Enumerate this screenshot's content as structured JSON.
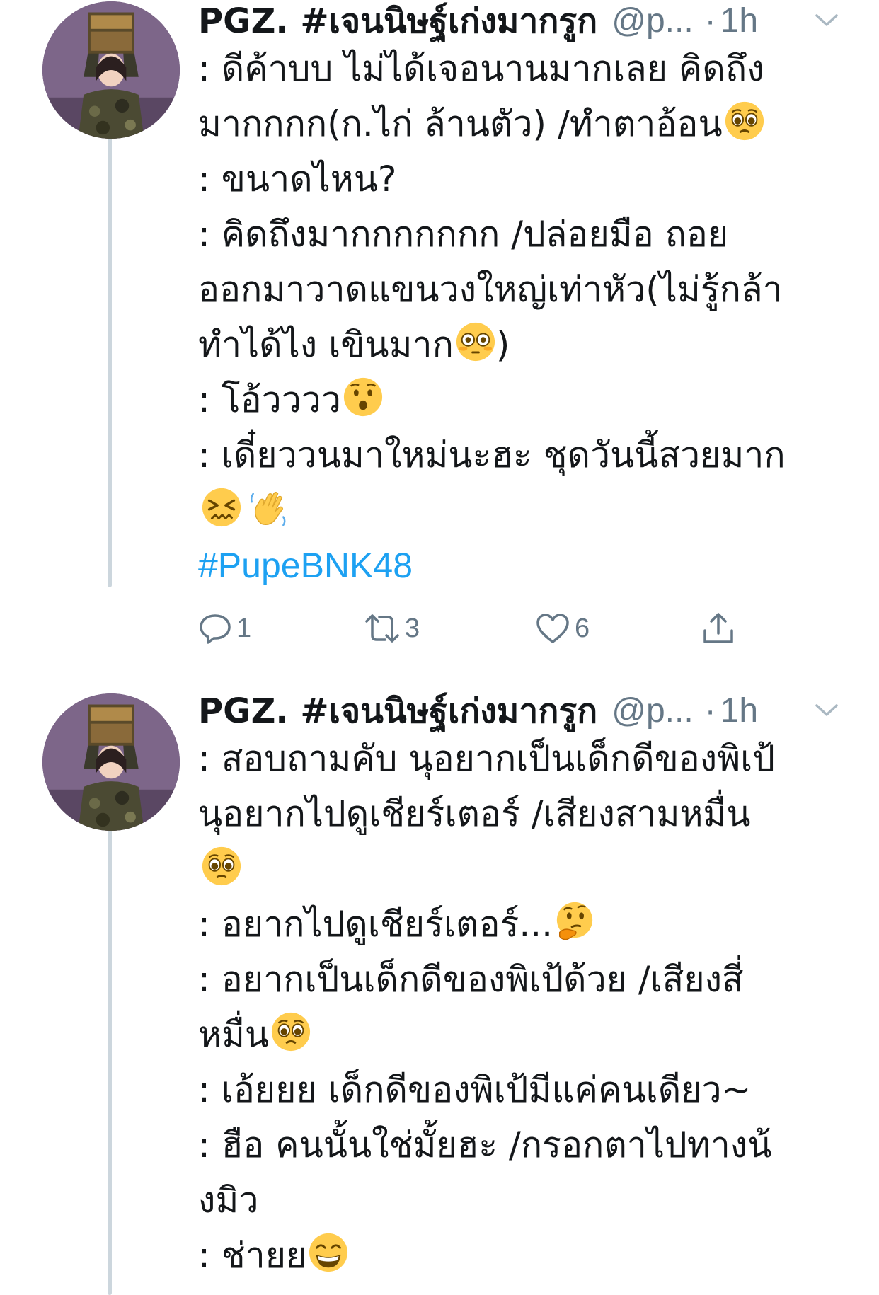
{
  "tweets": [
    {
      "display_name": "PGZ. #เจนนิษฐ์เก่งมากรูก",
      "handle": "@p...",
      "separator": "·",
      "time": "1h",
      "lines": [
        ": ดีค้าบบ ไม่ได้เจอนานมากเลย คิดถึง",
        "มากกกก(ก.ไก่ ล้านตัว) /ทำตาอ้อน",
        ": ขนาดไหน?",
        ": คิดถึงมากกกกกกก /ปล่อยมือ ถอย",
        "ออกมาวาดแขนวงใหญ่เท่าหัว(ไม่รู้กล้า",
        "ทำได้ไง เขินมาก",
        ")",
        ": โอ้วววว",
        ": เดี๋ยววนมาใหม่นะฮะ ชุดวันนี้สวยมาก"
      ],
      "hashtag": "#PupeBNK48",
      "actions": {
        "reply_count": "1",
        "retweet_count": "3",
        "like_count": "6"
      }
    },
    {
      "display_name": "PGZ. #เจนนิษฐ์เก่งมากรูก",
      "handle": "@p...",
      "separator": "·",
      "time": "1h",
      "lines": [
        ": สอบถามคับ นุอยากเป็นเด็กดีของพิเป้",
        "นุอยากไปดูเชียร์เตอร์ /เสียงสามหมื่น",
        ": อยากไปดูเชียร์เตอร์...",
        ": อยากเป็นเด็กดีของพิเป้ด้วย /เสียงสี่",
        "หมื่น",
        ": เอ้ยยย เด็กดีของพิเป้มีแค่คนเดียว~",
        ": ฮือ คนนั้นใช่มั้ยฮะ /กรอกตาไปทางน้",
        "งมิว",
        ": ช่ายย"
      ]
    }
  ],
  "icons": {
    "pleading": "pleading-face-icon",
    "flushed": "flushed-face-icon",
    "hushed": "hushed-face-icon",
    "confounded": "confounded-face-icon",
    "wave": "waving-hand-icon",
    "thinking": "thinking-face-icon",
    "grin": "grinning-face-icon",
    "reply": "reply-icon",
    "retweet": "retweet-icon",
    "like": "like-icon",
    "share": "share-icon",
    "caret": "chevron-down-icon"
  },
  "colors": {
    "text": "#14171a",
    "secondary": "#657786",
    "link": "#1da1f2",
    "thread_line": "#ccd6dd",
    "emoji_yellow": "#ffcc4d"
  }
}
